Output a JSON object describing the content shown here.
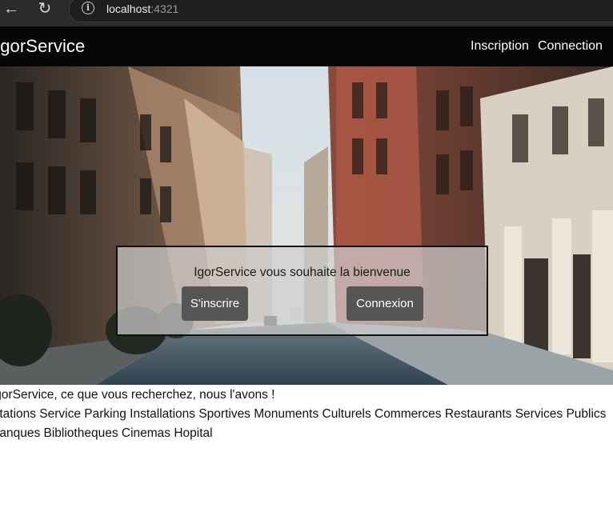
{
  "browser": {
    "url_host": "localhost",
    "url_port": ":4321",
    "back_icon": "arrow-left-icon",
    "reload_icon": "reload-icon",
    "info_icon": "info-icon"
  },
  "navbar": {
    "brand": "IgorService",
    "links": [
      "Inscription",
      "Connection"
    ],
    "background": "#050505"
  },
  "hero": {
    "welcome": "IgorService vous souhaite la bienvenue",
    "signup_button": "S'inscrire",
    "login_button": "Connexion",
    "button_color": "#555555"
  },
  "content": {
    "tagline": "IgorService, ce que vous recherchez, nous l'avons !",
    "categories_line1": "Stations Service Parking Installations Sportives Monuments Culturels Commerces Restaurants Services Publics",
    "categories_line2": "Banques Bibliotheques Cinemas Hopital"
  }
}
